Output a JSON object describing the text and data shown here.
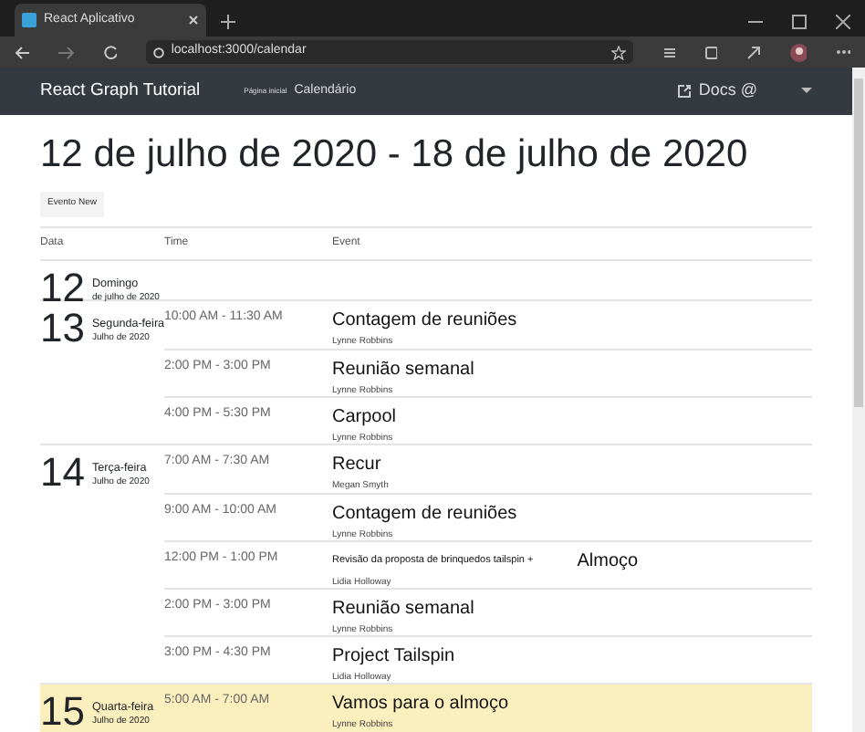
{
  "browser": {
    "tab_title": "React Aplicativo",
    "url": "localhost:3000/calendar"
  },
  "navbar": {
    "brand": "React Graph Tutorial",
    "links": [
      {
        "label": "Página inicial"
      },
      {
        "label": "Calendário"
      }
    ],
    "docs": "Docs @"
  },
  "heading": "12 de julho de 2020 - 18 de julho de 2020",
  "new_event_button": "Evento New",
  "table": {
    "columns": [
      "Data",
      "Time",
      "Event"
    ],
    "days": [
      {
        "number": "12",
        "weekday": "Domingo",
        "month_year": "de julho de 2020",
        "today": false
      },
      {
        "number": "13",
        "weekday": "Segunda-feira",
        "month_year": "Julho de 2020",
        "today": false,
        "events": [
          {
            "kind": "single",
            "time": "10:00 AM - 11:30 AM",
            "subject": "Contagem de reuniões",
            "organizer": "Lynne Robbins"
          },
          {
            "kind": "single",
            "time": "2:00 PM - 3:00 PM",
            "subject": "Reunião semanal",
            "organizer": "Lynne Robbins"
          },
          {
            "kind": "single",
            "time": "4:00 PM - 5:30 PM",
            "subject": "Carpool",
            "organizer": "Lynne Robbins"
          }
        ]
      },
      {
        "number": "14",
        "weekday": "Terça-feira",
        "month_year": "Julho de 2020",
        "today": false,
        "events": [
          {
            "kind": "single",
            "time": "7:00 AM - 7:30 AM",
            "subject": "Recur",
            "organizer": "Megan Smyth"
          },
          {
            "kind": "single",
            "time": "9:00 AM - 10:00 AM",
            "subject": "Contagem de reuniões",
            "organizer": "Lynne Robbins"
          },
          {
            "kind": "merged",
            "time": "12:00 PM - 1:00 PM",
            "subject": "Revisão da proposta de brinquedos tailspin +",
            "extra": "Almoço",
            "organizer": "Lidia Holloway"
          },
          {
            "kind": "single",
            "time": "2:00 PM - 3:00 PM",
            "subject": "Reunião semanal",
            "organizer": "Lynne Robbins"
          },
          {
            "kind": "single",
            "time": "3:00 PM - 4:30 PM",
            "subject": "Project Tailspin",
            "organizer": "Lidia Holloway"
          }
        ]
      },
      {
        "number": "15",
        "weekday": "Quarta-feira",
        "month_year": "Julho de 2020",
        "today": true,
        "events": [
          {
            "kind": "single",
            "time": "5:00 AM - 7:00 AM",
            "subject": "Vamos para o almoço",
            "organizer": "Lynne Robbins"
          }
        ]
      }
    ]
  }
}
